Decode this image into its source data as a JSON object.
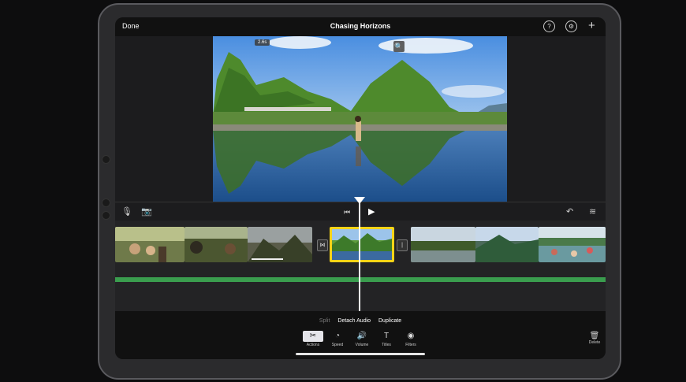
{
  "top_bar": {
    "done": "Done",
    "title": "Chasing Horizons",
    "help_icon": "?",
    "settings_icon": "⚙",
    "add_icon": "+"
  },
  "viewer": {
    "duration": "2.6s",
    "zoom_icon": "🔍"
  },
  "transport": {
    "mic_icon": "🎙",
    "camera_icon": "📷",
    "skip_back_icon": "⏮",
    "play_icon": "▶",
    "undo_icon": "↶",
    "waveform_icon": "≋"
  },
  "timeline": {
    "transition_icon_1": "⋈",
    "transition_icon_2": "|"
  },
  "clip_actions": {
    "split": "Split",
    "detach_audio": "Detach Audio",
    "duplicate": "Duplicate"
  },
  "tools": [
    {
      "label": "Actions",
      "icon": "✂"
    },
    {
      "label": "Speed",
      "icon": "◔"
    },
    {
      "label": "Volume",
      "icon": "🔊"
    },
    {
      "label": "Titles",
      "icon": "T"
    },
    {
      "label": "Filters",
      "icon": "◉"
    }
  ],
  "delete": {
    "label": "Delete",
    "icon": "🗑"
  },
  "colors": {
    "accent": "#f7d417",
    "audio": "#3a9d4e"
  }
}
